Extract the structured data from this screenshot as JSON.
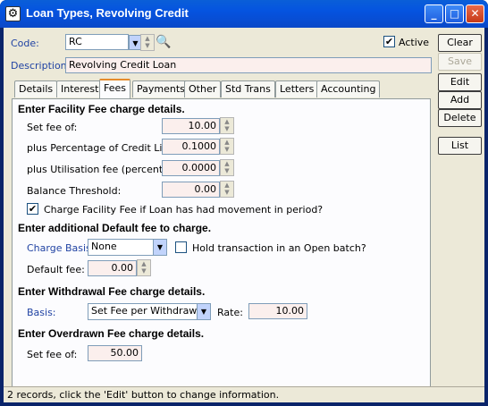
{
  "window": {
    "title": "Loan Types, Revolving Credit",
    "minimize": "_",
    "maximize": "□",
    "close": "✕"
  },
  "code": {
    "label": "Code:",
    "value": "RC",
    "search_icon": "binoculars-icon"
  },
  "active": {
    "label": "Active",
    "checked": true,
    "mark": "✔"
  },
  "description": {
    "label": "Description:",
    "value": "Revolving Credit Loan"
  },
  "buttons": {
    "clear": "Clear",
    "save": "Save",
    "edit": "Edit",
    "add": "Add",
    "delete": "Delete",
    "list": "List"
  },
  "tabs": [
    "Details",
    "Interest",
    "Fees",
    "Payments",
    "Other",
    "Std Trans",
    "Letters",
    "Accounting"
  ],
  "active_tab": "Fees",
  "facility": {
    "heading": "Enter Facility Fee charge details.",
    "set_fee_label": "Set fee of:",
    "set_fee": "10.00",
    "pct_label": "plus Percentage of Credit Limit:",
    "pct": "0.1000",
    "util_label": "plus Utilisation fee (percent):",
    "util": "0.0000",
    "threshold_label": "Balance Threshold:",
    "threshold": "0.00",
    "movement_label": "Charge Facility Fee if Loan has had movement in period?",
    "movement_checked": true,
    "movement_mark": "✔"
  },
  "default_fee": {
    "heading": "Enter additional Default fee to charge.",
    "basis_label": "Charge Basis:",
    "basis": "None",
    "hold_label": "Hold transaction in an Open batch?",
    "hold_checked": false,
    "fee_label": "Default fee:",
    "fee": "0.00"
  },
  "withdrawal": {
    "heading": "Enter Withdrawal Fee charge details.",
    "basis_label": "Basis:",
    "basis": "Set Fee per Withdrawal",
    "rate_label": "Rate:",
    "rate": "10.00"
  },
  "overdrawn": {
    "heading": "Enter Overdrawn Fee charge details.",
    "fee_label": "Set fee of:",
    "fee": "50.00"
  },
  "status": "2 records, click the 'Edit' button to change information."
}
